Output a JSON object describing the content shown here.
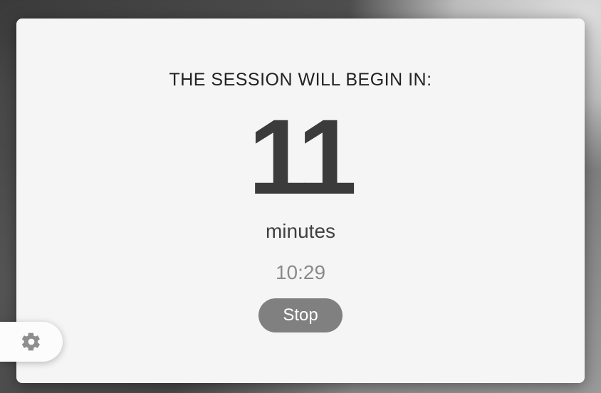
{
  "countdown": {
    "heading": "THE SESSION WILL BEGIN IN:",
    "minutes_value": "11",
    "unit_label": "minutes",
    "clock_time": "10:29",
    "stop_label": "Stop"
  },
  "icons": {
    "settings": "gear-icon"
  },
  "colors": {
    "card_bg": "#f5f5f5",
    "text_dark": "#3b3b3b",
    "text_muted": "#8a8a8a",
    "button_bg": "#808080"
  }
}
